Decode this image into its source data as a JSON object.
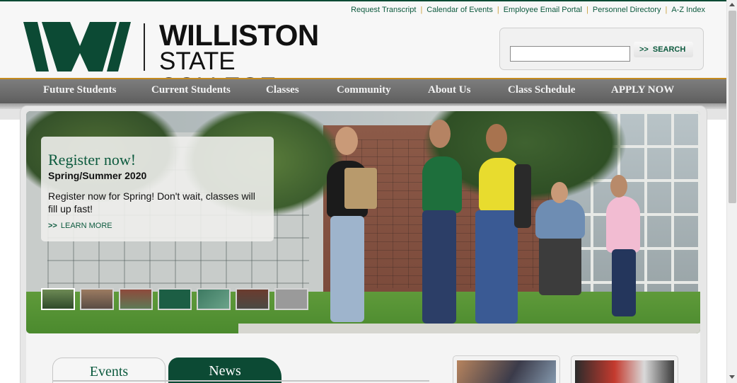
{
  "utility_links": [
    "Request Transcript",
    "Calendar of Events",
    "Employee Email Portal",
    "Personnel Directory",
    "A-Z Index"
  ],
  "logo": {
    "line1": "WILLISTON",
    "line2": "STATE COLLEGE",
    "mark_letter": "W"
  },
  "search": {
    "value": "",
    "button_label": "SEARCH",
    "button_arrow": ">>"
  },
  "nav": [
    "Future Students",
    "Current Students",
    "Classes",
    "Community",
    "About Us",
    "Class Schedule",
    "APPLY NOW"
  ],
  "hero": {
    "title": "Register now!",
    "subtitle": "Spring/Summer 2020",
    "body": "Register now for Spring! Don't wait, classes will fill up fast!",
    "more_arrow": ">>",
    "more_label": "LEARN MORE",
    "thumbnail_count": 7,
    "active_thumbnail": 1
  },
  "tabs": {
    "events": "Events",
    "news": "News",
    "active": "events"
  },
  "colors": {
    "brand_green": "#0c4a34",
    "accent_gold": "#c58b1f",
    "nav_grey": "#6b6b6b"
  }
}
